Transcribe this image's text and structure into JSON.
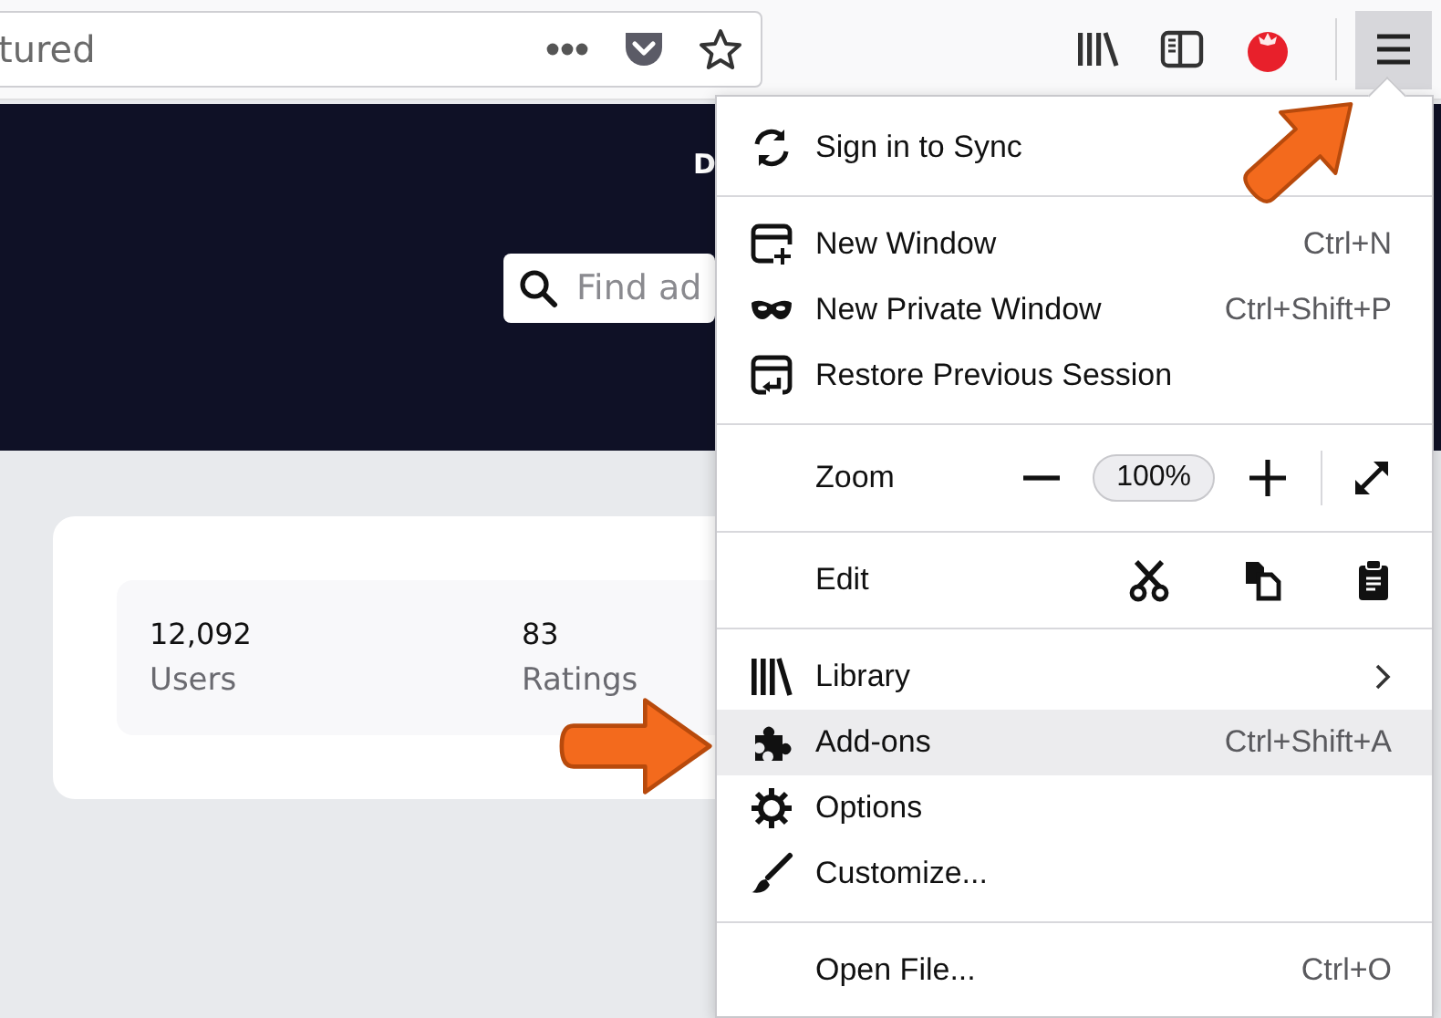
{
  "toolbar": {
    "url_text": "tured"
  },
  "page": {
    "header_link": "D",
    "search": {
      "placeholder": "Find ad"
    },
    "stats": [
      {
        "value": "12,092",
        "label": "Users"
      },
      {
        "value": "83",
        "label": "Ratings"
      }
    ]
  },
  "menu": {
    "items": [
      {
        "kind": "item",
        "label": "Sign in to Sync",
        "selected": false,
        "submenu": false
      },
      {
        "kind": "separator"
      },
      {
        "kind": "item",
        "label": "New Window",
        "shortcut": "Ctrl+N",
        "selected": false,
        "submenu": false
      },
      {
        "kind": "item",
        "label": "New Private Window",
        "shortcut": "Ctrl+Shift+P",
        "selected": false,
        "submenu": false
      },
      {
        "kind": "item",
        "label": "Restore Previous Session",
        "selected": false,
        "submenu": false
      },
      {
        "kind": "separator"
      },
      {
        "kind": "zoom",
        "label": "Zoom",
        "value": "100%"
      },
      {
        "kind": "separator"
      },
      {
        "kind": "edit",
        "label": "Edit"
      },
      {
        "kind": "separator"
      },
      {
        "kind": "item",
        "label": "Library",
        "selected": false,
        "submenu": true
      },
      {
        "kind": "item",
        "label": "Add-ons",
        "shortcut": "Ctrl+Shift+A",
        "selected": true,
        "submenu": false
      },
      {
        "kind": "item",
        "label": "Options",
        "selected": false,
        "submenu": false
      },
      {
        "kind": "item",
        "label": "Customize...",
        "selected": false,
        "submenu": false
      },
      {
        "kind": "separator"
      },
      {
        "kind": "item",
        "label": "Open File...",
        "shortcut": "Ctrl+O",
        "selected": false,
        "submenu": false
      }
    ]
  }
}
